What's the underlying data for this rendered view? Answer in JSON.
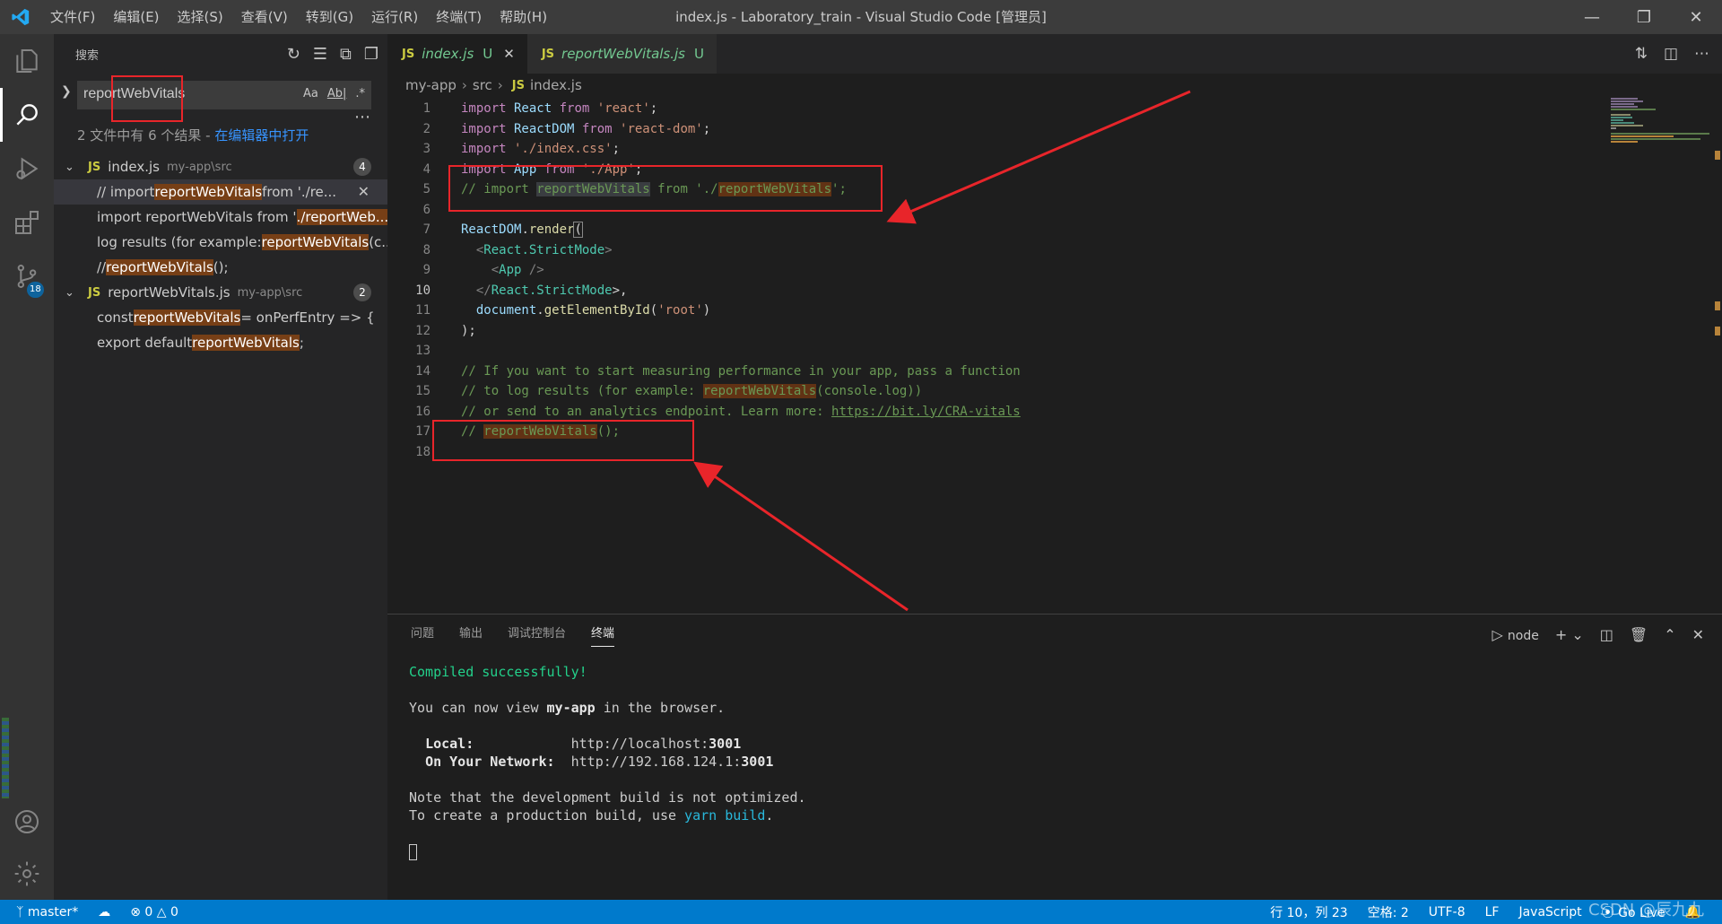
{
  "titlebar": {
    "menu": [
      "文件(F)",
      "编辑(E)",
      "选择(S)",
      "查看(V)",
      "转到(G)",
      "运行(R)",
      "终端(T)",
      "帮助(H)"
    ],
    "title": "index.js - Laboratory_train - Visual Studio Code [管理员]"
  },
  "activity": {
    "scm_badge": "18"
  },
  "sidebar": {
    "title": "搜索",
    "search_value": "reportWebVitals",
    "opt_case": "Aa",
    "opt_word": "Ab|",
    "opt_regex": ".*",
    "summary": "2 文件中有 6 个结果 - ",
    "open_in_editor": "在编辑器中打开",
    "files": [
      {
        "name": "index.js",
        "path": "my-app\\src",
        "count": "4",
        "matches": [
          {
            "pre": "// import ",
            "hit": "reportWebVitals",
            "post": " from './re..."
          },
          {
            "pre": "import reportWebVitals from '",
            "hit": "./reportWeb...",
            "post": ""
          },
          {
            "pre": "log results (for example: ",
            "hit": "reportWebVitals",
            "post": "(c..."
          },
          {
            "pre": "// ",
            "hit": "reportWebVitals",
            "post": "();"
          }
        ]
      },
      {
        "name": "reportWebVitals.js",
        "path": "my-app\\src",
        "count": "2",
        "matches": [
          {
            "pre": "const ",
            "hit": "reportWebVitals",
            "post": " = onPerfEntry => {"
          },
          {
            "pre": "export default ",
            "hit": "reportWebVitals",
            "post": ";"
          }
        ]
      }
    ]
  },
  "editor": {
    "tabs": [
      {
        "name": "index.js",
        "status": "U"
      },
      {
        "name": "reportWebVitals.js",
        "status": "U"
      }
    ],
    "breadcrumb": [
      "my-app",
      "src",
      "index.js"
    ],
    "line_numbers": [
      "1",
      "2",
      "3",
      "4",
      "5",
      "6",
      "7",
      "8",
      "9",
      "10",
      "11",
      "12",
      "13",
      "14",
      "15",
      "16",
      "17",
      "18"
    ],
    "code": {
      "l1": [
        "import",
        " React ",
        "from",
        " 'react'",
        ";"
      ],
      "l2": [
        "import",
        " ReactDOM ",
        "from",
        " 'react-dom'",
        ";"
      ],
      "l3": [
        "import",
        " './index.css'",
        ";"
      ],
      "l4": [
        "import",
        " App ",
        "from",
        " './App'",
        ";"
      ],
      "l5": [
        "// import ",
        "reportWebVitals",
        " from './",
        "reportWebVitals",
        "';"
      ],
      "l7": [
        "ReactDOM",
        ".",
        "render",
        "("
      ],
      "l8": [
        "<",
        "React.StrictMode",
        ">"
      ],
      "l9": [
        "<",
        "App",
        " />"
      ],
      "l10": [
        "</",
        "React.StrictMode",
        ">,"
      ],
      "l11": [
        "document",
        ".",
        "getElementById",
        "(",
        "'root'",
        ")"
      ],
      "l12": [
        ");"
      ],
      "l14": [
        "// If you want to start measuring performance in your app, pass a function"
      ],
      "l15": [
        "// to log results (for example: ",
        "reportWebVitals",
        "(console.log))"
      ],
      "l16": [
        "// or send to an analytics endpoint. Learn more: ",
        "https://bit.ly/CRA-vitals"
      ],
      "l17": [
        "// ",
        "reportWebVitals",
        "();"
      ]
    }
  },
  "panel": {
    "tabs": [
      "问题",
      "输出",
      "调试控制台",
      "终端"
    ],
    "terminal_name": "node",
    "terminal": {
      "compiled": "Compiled successfully!",
      "view_pre": "You can now view ",
      "app": "my-app",
      "view_post": " in the browser.",
      "local_label": "Local:",
      "local_url": "http://localhost:",
      "local_port": "3001",
      "network_label": "On Your Network:",
      "network_url": "http://192.168.124.1:",
      "network_port": "3001",
      "note": "Note that the development build is not optimized.",
      "create_pre": "To create a production build, use ",
      "yarn": "yarn",
      "build": "build",
      "create_post": "."
    }
  },
  "statusbar": {
    "branch": "master*",
    "errors": "0",
    "warnings": "0",
    "position": "行 10，列 23",
    "spaces": "空格: 2",
    "encoding": "UTF-8",
    "eol": "LF",
    "language": "JavaScript",
    "golive": "Go Live",
    "watermark": "CSDN @辰九九"
  },
  "colors": {
    "accent": "#007acc",
    "annotation": "#e8252a",
    "match_highlight": "#773f16"
  }
}
